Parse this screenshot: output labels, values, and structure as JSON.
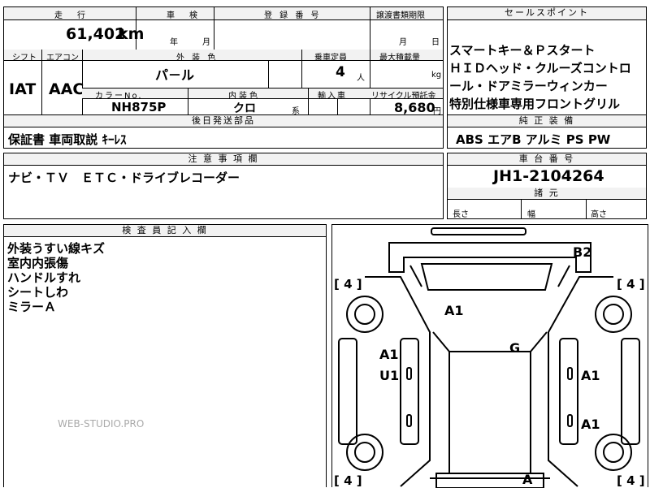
{
  "top_row": [
    "走　行",
    "車　検",
    "登 録 番 号",
    "譲渡書類期限",
    "セールスポイント"
  ],
  "mileage": "61,402",
  "mileage_unit": "km",
  "inspection": {
    "year": "年",
    "month": "月"
  },
  "transfer_deadline": {
    "month": "月",
    "day": "日"
  },
  "row2_headers": [
    "シフト",
    "エアコン",
    "外 装 色",
    "乗車定員",
    "最大積載量"
  ],
  "shift": "IAT",
  "aircon": "AAC",
  "exterior_color": "パ－ル",
  "capacity": "4",
  "capacity_unit": "人",
  "load_unit": "kg",
  "row3_headers": [
    "カラーNo.",
    "内装色",
    "輸入車",
    "リサイクル預託金"
  ],
  "color_no": "NH875P",
  "interior_color": "クロ",
  "interior_suffix": "系",
  "recycle_fee": "8,680",
  "yen": "円",
  "later_items_header": "後日発送部品",
  "later_items": "保証書 車両取説 ｷｰﾚｽ",
  "sales_points": [
    "スマートキー＆Ｐスタート",
    "ＨＩＤヘッド・クルーズコントロ",
    "ール・ドアミラーウィンカー",
    "特別仕様車専用フロントグリル"
  ],
  "equipment_header": "純 正 装 備",
  "equipment": "ABS エアB アルミ PS PW",
  "notes_header": "注 意 事 項 欄",
  "notes": "ナビ・ＴＶ　ＥＴＣ・ドライブレコーダー",
  "chassis_header": "車 台 番 号",
  "chassis_no": "JH1-2104264",
  "dims_header": "諸 元",
  "dims": [
    "長さ",
    "幅",
    "高さ"
  ],
  "inspector_header": "検 査 員 記 入 欄",
  "inspector_lines": [
    "外装うすい線キズ",
    "室内内張傷",
    "ハンドルすれ",
    "シートしわ",
    "ミラーＡ"
  ],
  "watermark": "WEB-STUDIO.PRO",
  "diagram": {
    "tire_marks": [
      "[ 4 ]",
      "[ 4 ]",
      "[ 4 ]",
      "[ 4 ]"
    ],
    "damage": [
      "B2",
      "A1",
      "G",
      "A1",
      "U1",
      "A1",
      "A1",
      "A1",
      "A"
    ]
  }
}
